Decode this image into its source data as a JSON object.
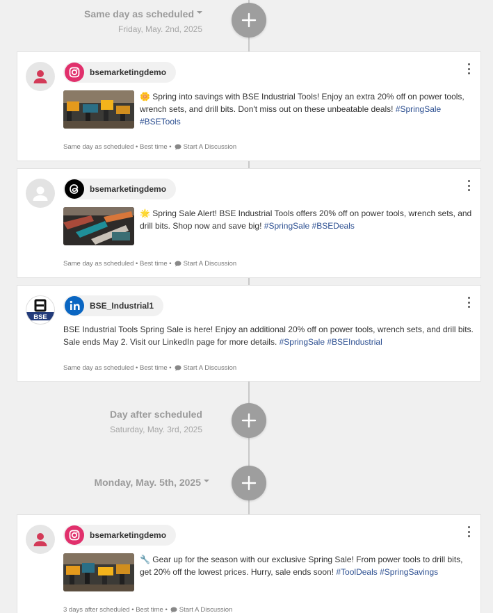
{
  "groups": [
    {
      "title": "Same day as scheduled",
      "date": "Friday, May. 2nd, 2025"
    },
    {
      "title": "Day after scheduled",
      "date": "Saturday, May. 3rd, 2025"
    },
    {
      "title": "Monday, May. 5th, 2025"
    }
  ],
  "posts": [
    {
      "network": "instagram",
      "account": "bsemarketingdemo",
      "emoji": "🌼",
      "text": " Spring into savings with BSE Industrial Tools! Enjoy an extra 20% off on power tools, wrench sets, and drill bits. Don't miss out on these unbeatable deals! ",
      "tags": [
        "#SpringSale",
        "#BSETools"
      ],
      "timing": "Same day as scheduled",
      "best_time": "Best time",
      "discussion": "Start A Discussion"
    },
    {
      "network": "threads",
      "account": "bsemarketingdemo",
      "emoji": "🌟",
      "text": " Spring Sale Alert! BSE Industrial Tools offers 20% off on power tools, wrench sets, and drill bits. Shop now and save big! ",
      "tags": [
        "#SpringSale",
        "#BSEDeals"
      ],
      "timing": "Same day as scheduled",
      "best_time": "Best time",
      "discussion": "Start A Discussion"
    },
    {
      "network": "linkedin",
      "account": "BSE_Industrial1",
      "avatar_text": "BSE",
      "text": "BSE Industrial Tools Spring Sale is here! Enjoy an additional 20% off on power tools, wrench sets, and drill bits. Sale ends May 2. Visit our LinkedIn page for more details. ",
      "tags": [
        "#SpringSale",
        "#BSEIndustrial"
      ],
      "timing": "Same day as scheduled",
      "best_time": "Best time",
      "discussion": "Start A Discussion"
    },
    {
      "network": "instagram",
      "account": "bsemarketingdemo",
      "emoji": "🔧",
      "text": " Gear up for the season with our exclusive Spring Sale! From power tools to drill bits, get 20% off the lowest prices. Hurry, sale ends soon! ",
      "tags": [
        "#ToolDeals",
        "#SpringSavings"
      ],
      "timing": "3 days after scheduled",
      "best_time": "Best time",
      "discussion": "Start A Discussion"
    }
  ],
  "colors": {
    "instagram": "#e1306c",
    "linkedin": "#0a66c2",
    "threads": "#000000",
    "hashtag": "#2c4f91",
    "add_button": "#9e9e9e"
  },
  "icons": [
    "plus-icon",
    "instagram-icon",
    "threads-icon",
    "linkedin-icon",
    "user-icon",
    "kebab-menu-icon",
    "chat-bubble-icon"
  ]
}
